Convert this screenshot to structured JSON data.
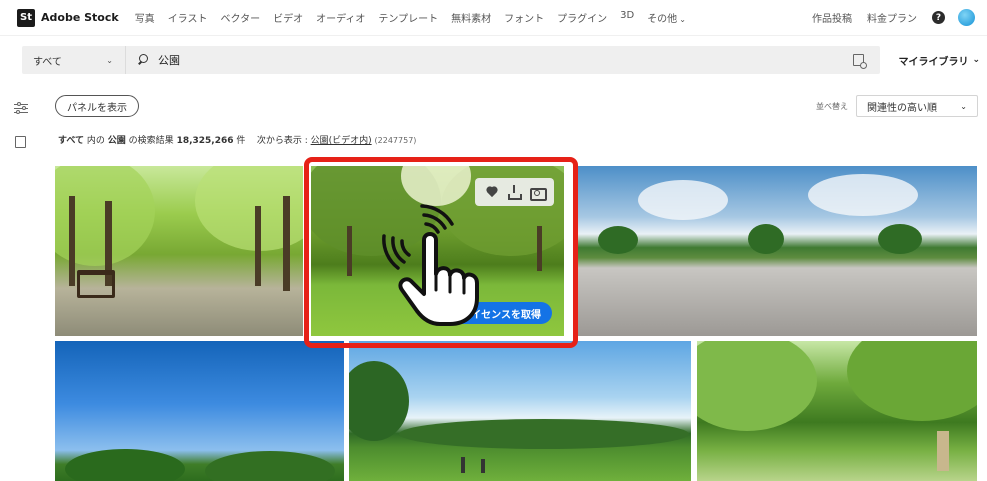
{
  "header": {
    "logo_badge": "St",
    "brand": "Adobe Stock",
    "nav": [
      {
        "label": "写真"
      },
      {
        "label": "イラスト"
      },
      {
        "label": "ベクター"
      },
      {
        "label": "ビデオ"
      },
      {
        "label": "オーディオ"
      },
      {
        "label": "テンプレート"
      },
      {
        "label": "無料素材"
      },
      {
        "label": "フォント"
      },
      {
        "label": "プラグイン"
      },
      {
        "label": "3D"
      },
      {
        "label": "その他"
      }
    ],
    "right_links": [
      {
        "label": "作品投稿"
      },
      {
        "label": "料金プラン"
      }
    ],
    "help_glyph": "?"
  },
  "search": {
    "scope": "すべて",
    "query": "公園",
    "library_label": "マイライブラリ"
  },
  "toolbar": {
    "panel_button": "パネルを表示",
    "sort_label": "並べ替え",
    "sort_value": "関連性の高い順"
  },
  "results": {
    "scope": "すべて",
    "in_text": "内の",
    "query": "公園",
    "suffix": "の検索結果",
    "count": "18,325,266",
    "unit": "件",
    "alt_label": "次から表示 :",
    "alt_link": "公園(ビデオ内)",
    "alt_count": "(2247757)"
  },
  "hover": {
    "license_button": "ライセンスを取得"
  },
  "colors": {
    "highlight": "#e62117",
    "license_blue": "#1473e6"
  }
}
